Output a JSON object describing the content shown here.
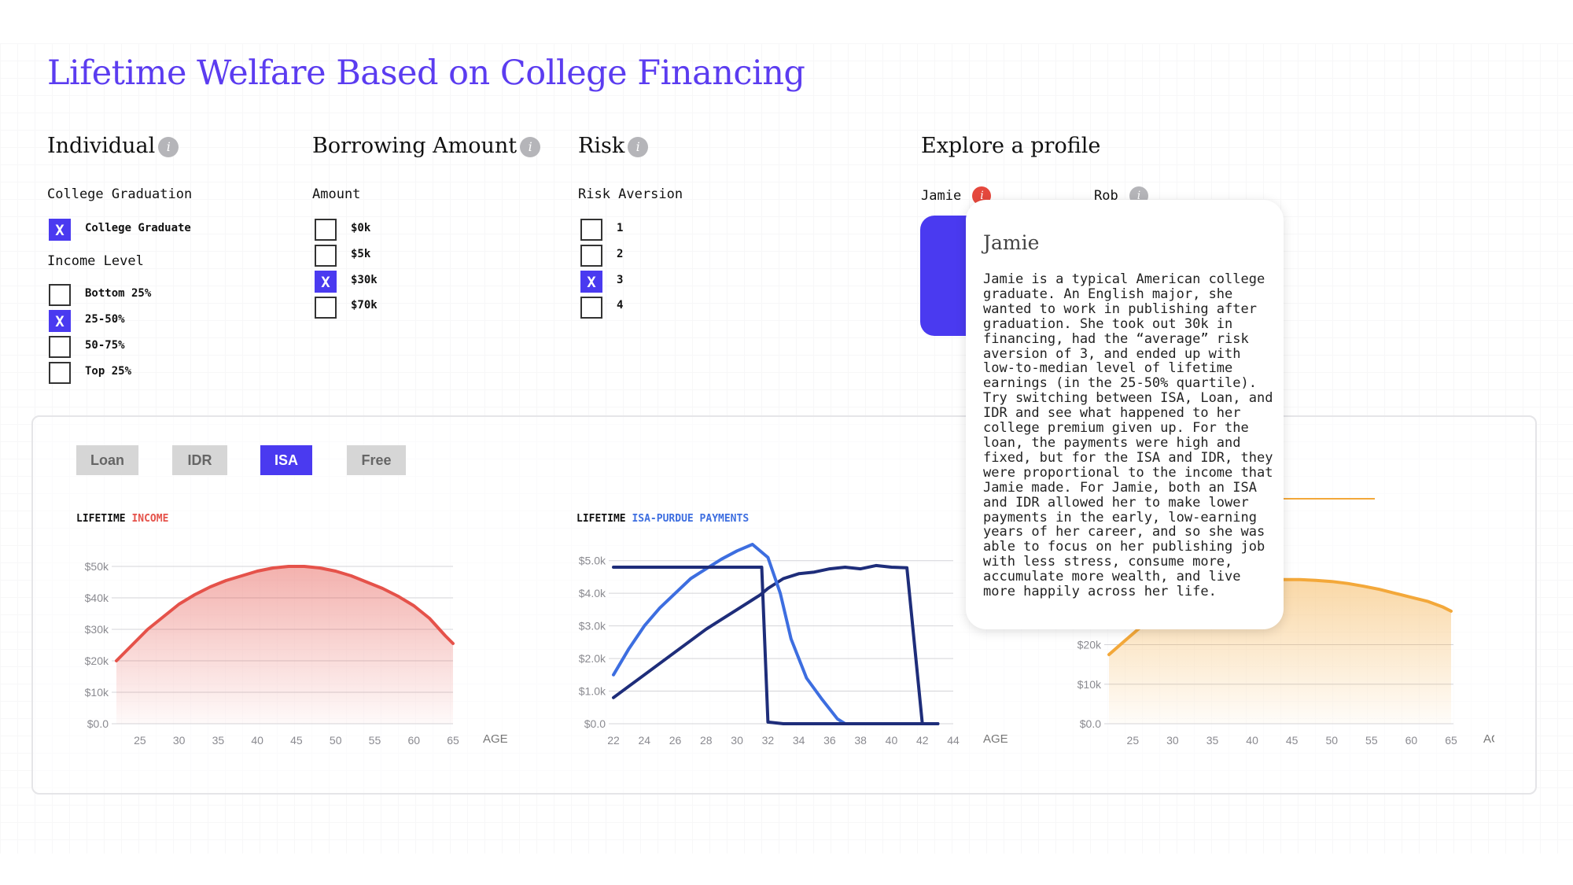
{
  "header": {
    "title": "Lifetime Welfare Based on College Financing"
  },
  "individual": {
    "title": "Individual",
    "info_icon": "i",
    "graduation_label": "College Graduation",
    "graduation_options": [
      {
        "label": "College Graduate",
        "checked": true,
        "mark": "X"
      }
    ],
    "income_label": "Income Level",
    "income_options": [
      {
        "label": "Bottom 25%",
        "checked": false
      },
      {
        "label": "25-50%",
        "checked": true,
        "mark": "X"
      },
      {
        "label": "50-75%",
        "checked": false
      },
      {
        "label": "Top 25%",
        "checked": false
      }
    ]
  },
  "borrowing": {
    "title": "Borrowing Amount",
    "info_icon": "i",
    "amount_label": "Amount",
    "options": [
      {
        "label": "$0k",
        "checked": false
      },
      {
        "label": "$5k",
        "checked": false
      },
      {
        "label": "$30k",
        "checked": true,
        "mark": "X"
      },
      {
        "label": "$70k",
        "checked": false
      }
    ]
  },
  "risk": {
    "title": "Risk",
    "info_icon": "i",
    "aversion_label": "Risk Aversion",
    "options": [
      {
        "label": "1",
        "checked": false
      },
      {
        "label": "2",
        "checked": false
      },
      {
        "label": "3",
        "checked": true,
        "mark": "X"
      },
      {
        "label": "4",
        "checked": false
      }
    ]
  },
  "profiles": {
    "title": "Explore a profile",
    "items": [
      {
        "name": "Jamie",
        "info_icon": "i"
      },
      {
        "name": "Rob",
        "info_icon": "i"
      }
    ]
  },
  "popup": {
    "name": "Jamie",
    "text": "Jamie is a typical American college\ngraduate. An English major, she\nwanted to work in publishing after\ngraduation. She took out 30k in\nfinancing, had the “average” risk\naversion of 3, and ended up with\nlow-to-median level of lifetime\nearnings (in the 25-50% quartile).\nTry switching between ISA, Loan, and\nIDR and see what happened to her\ncollege premium given up. For the\nloan, the payments were high and\nfixed, but for the ISA and IDR, they\nwere proportional to the income that\nJamie made. For Jamie, both an ISA\nand IDR allowed her to make lower\npayments in the early, low-earning\nyears of her career, and so she was\nable to focus on her publishing job\nwith less stress, consume more,\naccumulate more wealth, and live\nmore happily across her life."
  },
  "tabs": [
    {
      "label": "Loan",
      "active": false
    },
    {
      "label": "IDR",
      "active": false
    },
    {
      "label": "ISA",
      "active": true
    },
    {
      "label": "Free",
      "active": false
    }
  ],
  "colors": {
    "accent": "#4a3af0",
    "income": "#e5524a",
    "payment": "#3d6ee0",
    "payment_dark": "#1e2d7a",
    "consumption": "#f3a83a"
  },
  "chart_data": [
    {
      "type": "area",
      "title_prefix": "LIFETIME",
      "title_highlight": "INCOME",
      "x_unit_label": "AGE",
      "x_ticks": [
        "25",
        "30",
        "35",
        "40",
        "45",
        "50",
        "55",
        "60",
        "65"
      ],
      "y_ticks": [
        "$0.0",
        "$10k",
        "$20k",
        "$30k",
        "$40k",
        "$50k"
      ],
      "xlim": [
        22,
        65
      ],
      "ylim": [
        0,
        55
      ],
      "series": [
        {
          "x": [
            22,
            24,
            26,
            28,
            30,
            32,
            34,
            36,
            38,
            40,
            42,
            44,
            46,
            48,
            50,
            52,
            54,
            56,
            58,
            60,
            62,
            64,
            65
          ],
          "y": [
            20,
            25,
            30,
            34,
            38,
            41,
            43.5,
            45.5,
            47,
            48.5,
            49.5,
            50,
            50,
            49.5,
            48.5,
            47,
            45,
            43,
            40.5,
            37.5,
            33.5,
            28,
            25.5
          ]
        }
      ]
    },
    {
      "type": "line",
      "title_prefix": "LIFETIME",
      "title_highlight": "ISA-PURDUE PAYMENTS",
      "x_unit_label": "AGE",
      "x_ticks": [
        "22",
        "24",
        "26",
        "28",
        "30",
        "32",
        "34",
        "36",
        "38",
        "40",
        "42",
        "44"
      ],
      "y_ticks": [
        "$0.0",
        "$1.0k",
        "$2.0k",
        "$3.0k",
        "$4.0k",
        "$5.0k"
      ],
      "xlim": [
        22,
        44
      ],
      "ylim": [
        0,
        5.5
      ],
      "series": [
        {
          "x": [
            22,
            23,
            24,
            25,
            26,
            27,
            28,
            29,
            30,
            31,
            31.5,
            32,
            33,
            34,
            35,
            36,
            37,
            38,
            39,
            40,
            41,
            42,
            43
          ],
          "y": [
            0.8,
            1.15,
            1.5,
            1.85,
            2.2,
            2.55,
            2.9,
            3.2,
            3.5,
            3.8,
            3.95,
            4.15,
            4.45,
            4.6,
            4.65,
            4.75,
            4.8,
            4.75,
            4.85,
            4.8,
            4.78,
            0,
            0
          ]
        },
        {
          "x": [
            22,
            23,
            24,
            25,
            26,
            27,
            28,
            29,
            30,
            31,
            32,
            32.8,
            33.5,
            34.5,
            35.5,
            36.5,
            37,
            38,
            39,
            40,
            41,
            42,
            43
          ],
          "y": [
            1.5,
            2.3,
            3.0,
            3.55,
            4.0,
            4.45,
            4.75,
            5.05,
            5.3,
            5.5,
            5.1,
            4.0,
            2.6,
            1.4,
            0.75,
            0.15,
            0,
            0,
            0,
            0,
            0,
            0,
            0
          ]
        },
        {
          "x": [
            22,
            31,
            31.6,
            32,
            33,
            34,
            35,
            36,
            37,
            38,
            39,
            40,
            41,
            42,
            43
          ],
          "y": [
            4.8,
            4.8,
            4.8,
            0.05,
            0,
            0,
            0,
            0,
            0,
            0,
            0,
            0,
            0,
            0,
            0
          ]
        }
      ]
    },
    {
      "type": "area",
      "x_unit_label": "AGE",
      "x_ticks": [
        "25",
        "30",
        "35",
        "40",
        "45",
        "50",
        "55",
        "60",
        "65"
      ],
      "y_ticks": [
        "$0.0",
        "$10k",
        "$20k"
      ],
      "xlim": [
        22,
        65
      ],
      "ylim": [
        0,
        45
      ],
      "series": [
        {
          "x": [
            22,
            24,
            26,
            28,
            30,
            32,
            34,
            36,
            38,
            40,
            42,
            44,
            46,
            48,
            50,
            52,
            54,
            56,
            58,
            60,
            62,
            64,
            65
          ],
          "y": [
            17.5,
            21,
            24.5,
            27.5,
            30,
            32,
            33.5,
            34.5,
            35.5,
            36,
            36.5,
            36.5,
            36.5,
            36.3,
            36,
            35.5,
            34.8,
            34,
            33,
            32,
            31,
            29.5,
            28.5
          ]
        }
      ]
    }
  ]
}
